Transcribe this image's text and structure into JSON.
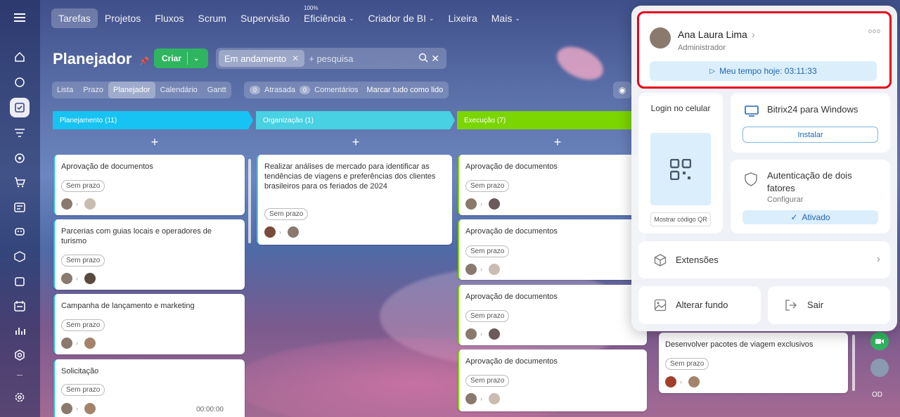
{
  "nav": {
    "items": [
      "Tarefas",
      "Projetos",
      "Fluxos",
      "Scrum",
      "Supervisão",
      "Eficiência",
      "Criador de BI",
      "Lixeira",
      "Mais"
    ],
    "efficiency_percent": "100%"
  },
  "planner": {
    "title": "Planejador",
    "create_label": "Criar",
    "filter_chip": "Em andamento",
    "search_placeholder": "+ pesquisa",
    "views": [
      "Lista",
      "Prazo",
      "Planejador",
      "Calendário",
      "Gantt"
    ],
    "active_view": "Planejador",
    "counters": {
      "overdue_count": "0",
      "overdue_label": "Atrasada",
      "comments_count": "0",
      "comments_label": "Comentários",
      "mark_all": "Marcar tudo como lido"
    }
  },
  "columns": [
    {
      "name": "Planejamento",
      "count": "(11)",
      "color": "#17c3f2"
    },
    {
      "name": "Organização",
      "count": "(1)",
      "color": "#47d1e2"
    },
    {
      "name": "Execução",
      "count": "(7)",
      "color": "#7bd500"
    }
  ],
  "cards": {
    "col1": [
      {
        "title": "Aprovação de documentos",
        "tag": "Sem prazo"
      },
      {
        "title": "Parcerias com guias locais e operadores de turismo",
        "tag": "Sem prazo"
      },
      {
        "title": "Campanha de lançamento e marketing",
        "tag": "Sem prazo"
      },
      {
        "title": "Solicitação",
        "tag": "Sem prazo",
        "timer": "00:00:00"
      }
    ],
    "col2": [
      {
        "title": "Realizar análises de mercado para identificar as tendências de viagens e preferências dos clientes brasileiros para os feriados de 2024",
        "tag": "Sem prazo"
      }
    ],
    "col3": [
      {
        "title": "Aprovação de documentos",
        "tag": "Sem prazo"
      },
      {
        "title": "Aprovação de documentos",
        "tag": "Sem prazo"
      },
      {
        "title": "Aprovação de documentos",
        "tag": "Sem prazo"
      },
      {
        "title": "Aprovação de documentos",
        "tag": "Sem prazo"
      }
    ],
    "col4": [
      {
        "title": "Desenvolver pacotes de viagem exclusivos",
        "tag": "Sem prazo"
      }
    ]
  },
  "profile": {
    "name": "Ana Laura Lima",
    "role": "Administrador",
    "more": "ooo",
    "timer_label": "Meu tempo hoje: 03:11:33",
    "mobile_title": "Login no celular",
    "show_qr": "Mostrar código QR",
    "desktop_title": "Bitrix24 para Windows",
    "install_label": "Instalar",
    "twofa_title": "Autenticação de dois fatores",
    "twofa_sub": "Configurar",
    "twofa_status": "Ativado",
    "extensions": "Extensões",
    "change_bg": "Alterar fundo",
    "logout": "Sair"
  },
  "right_rail": {
    "initials": "OD"
  },
  "colors": {
    "accent_red": "#e8001c",
    "green": "#2fb560",
    "link_blue": "#2066b0"
  }
}
